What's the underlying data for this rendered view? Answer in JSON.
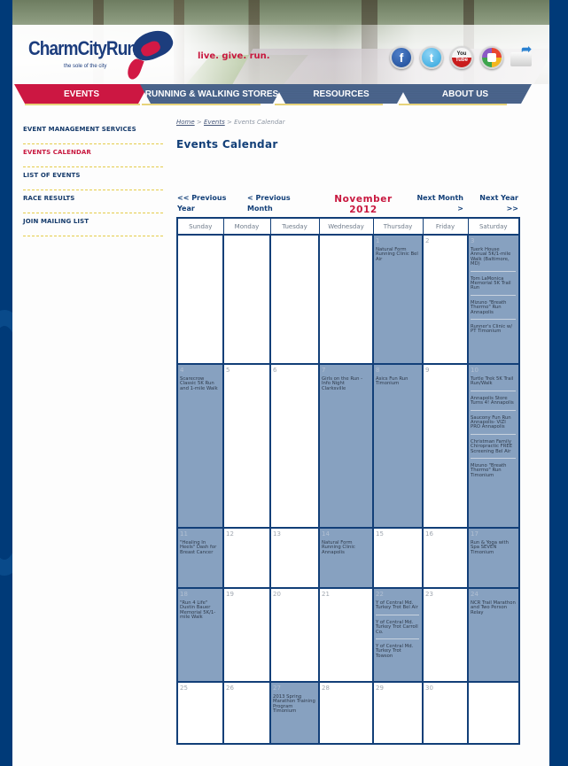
{
  "header": {
    "logo_text": "CharmCityRun",
    "logo_tagline": "the sole of the city",
    "tagline": "live. give. run.",
    "social": [
      {
        "name": "facebook",
        "glyph": "f"
      },
      {
        "name": "twitter",
        "glyph": "t"
      },
      {
        "name": "youtube",
        "glyph_top": "You",
        "glyph_bottom": "Tube"
      },
      {
        "name": "picasa",
        "glyph": ""
      },
      {
        "name": "email-share",
        "glyph": "➦"
      }
    ]
  },
  "nav": {
    "items": [
      {
        "label": "EVENTS",
        "active": true
      },
      {
        "label": "RUNNING & WALKING STORES",
        "active": false
      },
      {
        "label": "RESOURCES",
        "active": false
      },
      {
        "label": "ABOUT US",
        "active": false
      }
    ]
  },
  "sidebar": {
    "items": [
      {
        "label": "EVENT MANAGEMENT SERVICES",
        "active": false
      },
      {
        "label": "EVENTS CALENDAR",
        "active": true
      },
      {
        "label": "LIST OF EVENTS",
        "active": false
      },
      {
        "label": "RACE RESULTS",
        "active": false
      },
      {
        "label": "JOIN MAILING LIST",
        "active": false
      }
    ]
  },
  "breadcrumb": {
    "items": [
      "Home",
      "Events",
      "Events Calendar"
    ],
    "separator": ">"
  },
  "page_title": "Events Calendar",
  "calendar": {
    "prev_year": "<< Previous Year",
    "prev_month": "< Previous Month",
    "month_title": "November 2012",
    "next_month": "Next Month >",
    "next_year": "Next Year >>",
    "weekdays": [
      "Sunday",
      "Monday",
      "Tuesday",
      "Wednesday",
      "Thursday",
      "Friday",
      "Saturday"
    ],
    "weeks": [
      [
        {
          "day": "",
          "events": []
        },
        {
          "day": "",
          "events": []
        },
        {
          "day": "",
          "events": []
        },
        {
          "day": "",
          "events": []
        },
        {
          "day": "1",
          "events": [
            "Natural Form Running Clinic Bel Air"
          ]
        },
        {
          "day": "2",
          "events": []
        },
        {
          "day": "3",
          "events": [
            "Tuerk House Annual 5K/1-mile Walk (Baltimore, MD)",
            "Tom LaMonica Memorial 5K Trail Run",
            "Mizuno \"Breath Thermo\" Run Annapolis",
            "Runner's Clinic w/ PT Timonium"
          ]
        }
      ],
      [
        {
          "day": "4",
          "events": [
            "Scarecrow Classic 5K Run and 1-mile Walk"
          ]
        },
        {
          "day": "5",
          "events": []
        },
        {
          "day": "6",
          "events": []
        },
        {
          "day": "7",
          "events": [
            "Girls on the Run - Info Night Clarksville"
          ]
        },
        {
          "day": "8",
          "events": [
            "Asics Fun Run Timonium"
          ]
        },
        {
          "day": "9",
          "events": []
        },
        {
          "day": "10",
          "events": [
            "Turtle Trek 5K Trail Run/Walk",
            "Annapolis Store Turns 4! Annapolis",
            "Saucony Fun Run Annapolis- VIZI PRO Annapolis",
            "Christman Family Chiropractic FREE Screening Bel Air",
            "Mizuno \"Breath Thermo\" Run Timonium"
          ]
        }
      ],
      [
        {
          "day": "11",
          "events": [
            "\"Healing In Heels\" Dash for Breast Cancer"
          ]
        },
        {
          "day": "12",
          "events": []
        },
        {
          "day": "13",
          "events": []
        },
        {
          "day": "14",
          "events": [
            "Natural Form Running Clinic Annapolis"
          ]
        },
        {
          "day": "15",
          "events": []
        },
        {
          "day": "16",
          "events": []
        },
        {
          "day": "17",
          "events": [
            "Run & Yoga with Spa SEVEN Timonium"
          ]
        }
      ],
      [
        {
          "day": "18",
          "events": [
            "\"Run 4 Life\" Dustin Bauer Memorial 5K/1-mile Walk"
          ]
        },
        {
          "day": "19",
          "events": []
        },
        {
          "day": "20",
          "events": []
        },
        {
          "day": "21",
          "events": []
        },
        {
          "day": "22",
          "events": [
            "Y of Central Md. Turkey Trot Bel Air",
            "Y of Central Md. Turkey Trot Carroll Co.",
            "Y of Central Md. Turkey Trot Towson"
          ]
        },
        {
          "day": "23",
          "events": []
        },
        {
          "day": "24",
          "events": [
            "NCR Trail Marathon and Two Person Relay"
          ]
        }
      ],
      [
        {
          "day": "25",
          "events": []
        },
        {
          "day": "26",
          "events": []
        },
        {
          "day": "27",
          "events": [
            "2013 Spring Marathon Training Program Timonium"
          ]
        },
        {
          "day": "28",
          "events": []
        },
        {
          "day": "29",
          "events": []
        },
        {
          "day": "30",
          "events": []
        },
        {
          "day": "",
          "events": []
        }
      ]
    ]
  },
  "colors": {
    "brand_navy": "#123f78",
    "brand_red": "#c8183f",
    "event_cell": "#87a1c0",
    "divider_gold": "#e5cc4b"
  }
}
